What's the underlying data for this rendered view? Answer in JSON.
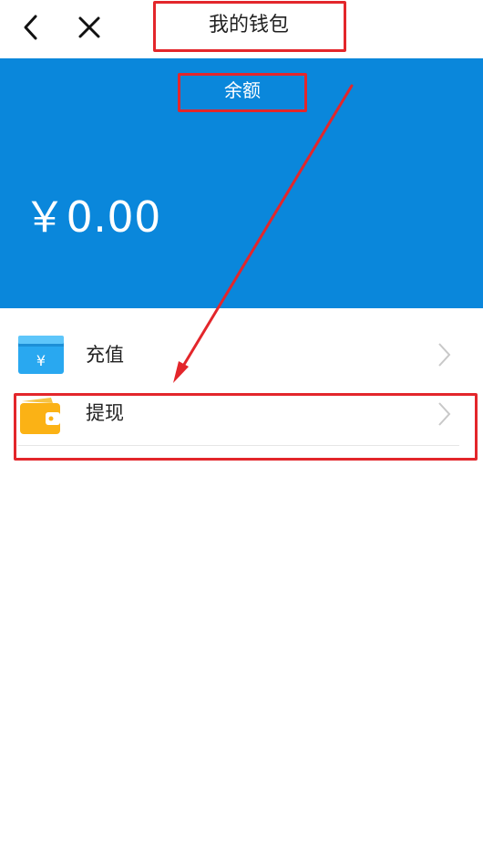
{
  "nav": {
    "title": "我的钱包",
    "back_icon": "chevron-left-icon",
    "close_icon": "close-icon"
  },
  "balance": {
    "label": "余额",
    "amount": "￥0.00",
    "background_color": "#0a87db"
  },
  "menu": [
    {
      "label": "充值",
      "icon": "recharge-card-icon",
      "icon_color": "#29a8f0"
    },
    {
      "label": "提现",
      "icon": "wallet-icon",
      "icon_color": "#fbb215"
    }
  ],
  "annotation_color": "#e3262b"
}
